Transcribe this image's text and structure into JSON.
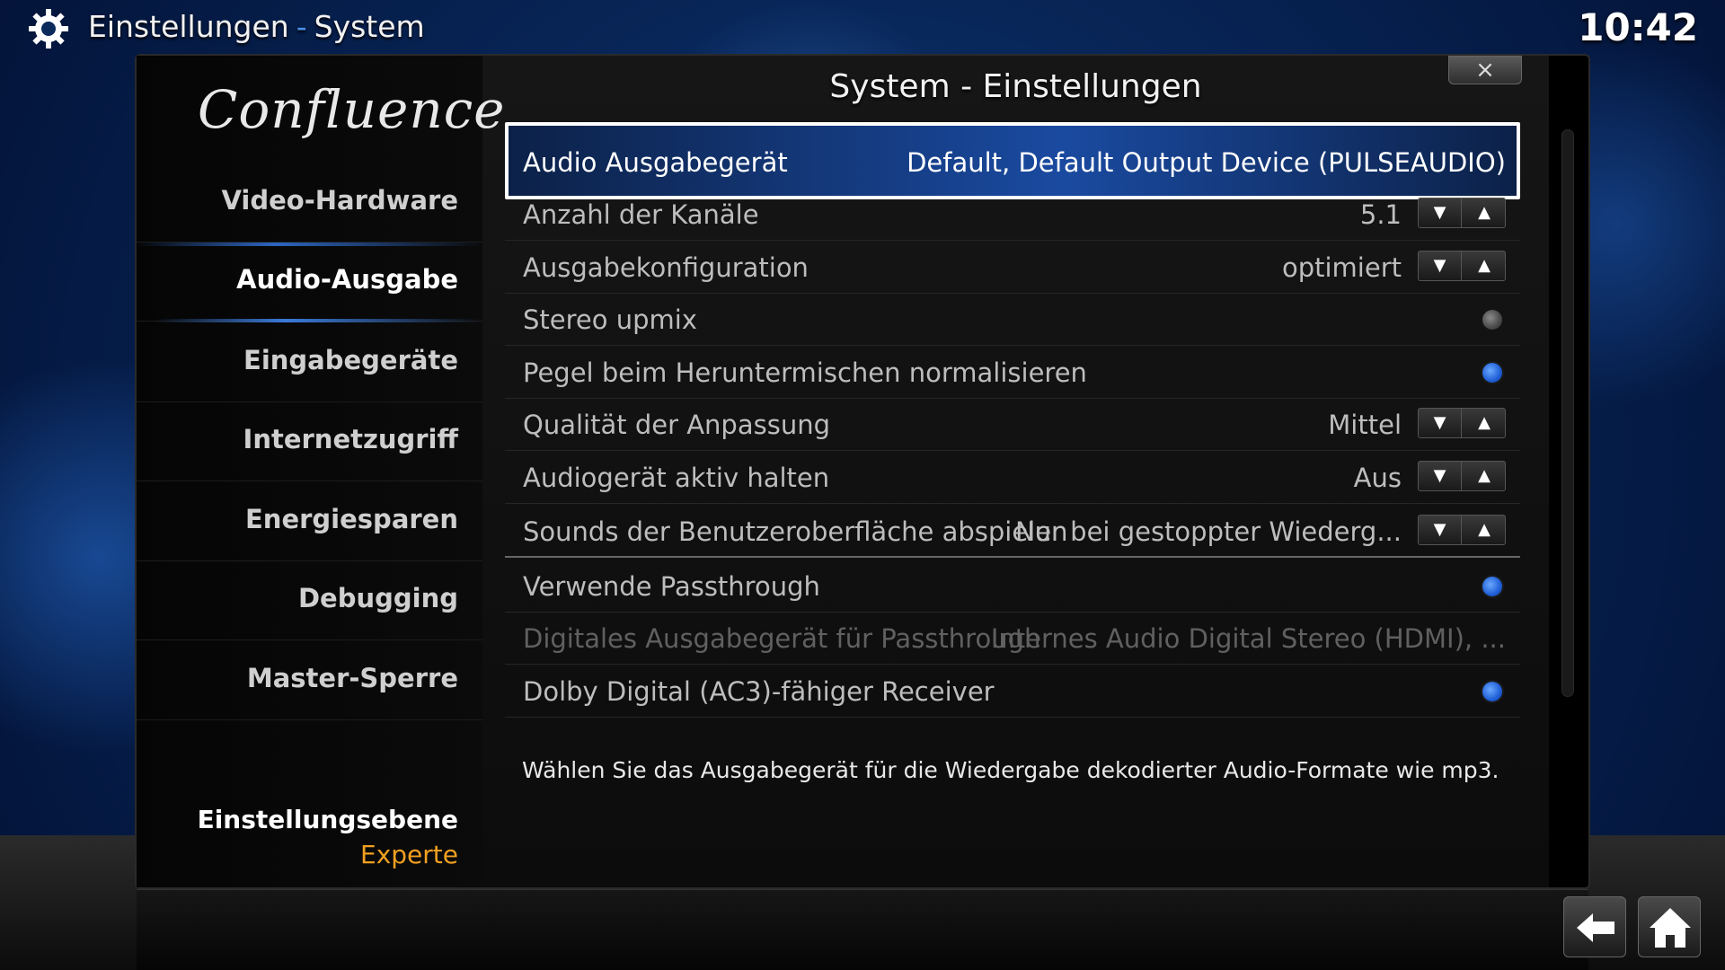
{
  "header": {
    "section": "Einstellungen",
    "separator": "-",
    "page": "System",
    "clock": "10:42"
  },
  "sidebar": {
    "logo": "Confluence",
    "items": [
      {
        "label": "Video-Hardware",
        "active": false
      },
      {
        "label": "Audio-Ausgabe",
        "active": true
      },
      {
        "label": "Eingabegeräte",
        "active": false
      },
      {
        "label": "Internetzugriff",
        "active": false
      },
      {
        "label": "Energiesparen",
        "active": false
      },
      {
        "label": "Debugging",
        "active": false
      },
      {
        "label": "Master-Sperre",
        "active": false
      }
    ],
    "level_label": "Einstellungsebene",
    "level_value": "Experte"
  },
  "dialog": {
    "title": "System - Einstellungen",
    "close_label": "×"
  },
  "settings": [
    {
      "label": "Audio Ausgabegerät",
      "value": "Default, Default Output Device (PULSEAUDIO)",
      "type": "value",
      "selected": true
    },
    {
      "label": "Anzahl der Kanäle",
      "value": "5.1",
      "type": "spinner"
    },
    {
      "label": "Ausgabekonfiguration",
      "value": "optimiert",
      "type": "spinner"
    },
    {
      "label": "Stereo upmix",
      "type": "toggle",
      "checked": false
    },
    {
      "label": "Pegel beim Heruntermischen normalisieren",
      "type": "toggle",
      "checked": true
    },
    {
      "label": "Qualität der Anpassung",
      "value": "Mittel",
      "type": "spinner"
    },
    {
      "label": "Audiogerät aktiv halten",
      "value": "Aus",
      "type": "spinner"
    },
    {
      "label": "Sounds der Benutzeroberfläche abspielen",
      "value": "Nur bei gestoppter Wiederg...",
      "type": "spinner"
    },
    {
      "label": "Verwende Passthrough",
      "type": "toggle",
      "checked": true
    },
    {
      "label": "Digitales Ausgabegerät für Passthrough",
      "value": "Internes Audio Digital Stereo (HDMI), ...",
      "type": "value",
      "disabled": true
    },
    {
      "label": "Dolby Digital (AC3)-fähiger Receiver",
      "type": "toggle",
      "checked": true
    }
  ],
  "spinner_glyphs": {
    "down": "▼",
    "up": "▲"
  },
  "description": "Wählen Sie das Ausgabegerät für die Wiedergabe dekodierter Audio-Formate wie mp3.",
  "nav": {
    "back_icon": "back-arrow-icon",
    "home_icon": "home-icon"
  },
  "colors": {
    "accent": "#3a7ad8",
    "level_value": "#f0a020",
    "background": "#082658"
  }
}
